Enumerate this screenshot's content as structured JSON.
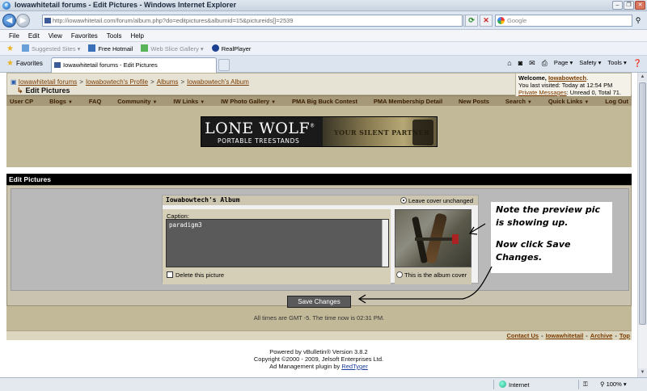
{
  "window": {
    "title": "Iowawhitetail forums - Edit Pictures - Windows Internet Explorer",
    "minimize": "–",
    "maximize": "❐",
    "close": "✕"
  },
  "address": {
    "url_host": "http://iowawhitetail.com",
    "url_path": "/forum/album.php?do=editpictures&albumid=15&pictureids[]=2539",
    "search_placeholder": "Google"
  },
  "menu": [
    "File",
    "Edit",
    "View",
    "Favorites",
    "Tools",
    "Help"
  ],
  "links_bar": {
    "suggested": "Suggested Sites ▾",
    "hotmail": "Free Hotmail",
    "webslice": "Web Slice Gallery ▾",
    "realplayer": "RealPlayer"
  },
  "tabs": {
    "favorites": "Favorites",
    "active_tab": "Iowawhitetail forums - Edit Pictures"
  },
  "commands": {
    "page": "Page ▾",
    "safety": "Safety ▾",
    "tools": "Tools ▾"
  },
  "breadcrumb": {
    "items": [
      "Iowawhitetail forums",
      "Iowabowtech's Profile",
      "Albums",
      "Iowabowtech's Album"
    ],
    "separator": ">",
    "page_title": "Edit Pictures"
  },
  "welcome": {
    "prefix": "Welcome,",
    "user": "Iowabowtech",
    "last_visited": "You last visited: Today at 12:54 PM",
    "pm_label": "Private Messages",
    "pm_status": ": Unread 0, Total 71."
  },
  "navbar": [
    "User CP",
    "Blogs",
    "FAQ",
    "Community",
    "IW Links",
    "IW Photo Gallery",
    "PMA Big Buck Contest",
    "PMA Membership Detail",
    "New Posts",
    "Search",
    "Quick Links",
    "Log Out"
  ],
  "banner": {
    "brand": "LONE WOLF",
    "tagline": "PORTABLE TREESTANDS",
    "partner": "YOUR SILENT PARTNER"
  },
  "section_title": "Edit Pictures",
  "album": {
    "title": "Iowabowtech's Album",
    "leave_cover": "Leave cover unchanged",
    "caption_label": "Caption:",
    "caption_value": "paradigm3",
    "delete_label": "Delete this picture",
    "album_cover_label": "This is the album cover"
  },
  "note": {
    "line1": "Note the preview pic is showing up.",
    "line2": "Now click Save Changes."
  },
  "save_button": "Save Changes",
  "gmt_text": "All times are GMT -5. The time now is 02:31 PM.",
  "footer_links": [
    "Contact Us",
    "Iowawhitetail",
    "Archive",
    "Top"
  ],
  "copyright": {
    "line1": "Powered by vBulletin® Version 3.8.2",
    "line2": "Copyright ©2000 - 2009, Jelsoft Enterprises Ltd.",
    "line3_prefix": "Ad Management plugin by",
    "line3_link": "RedTyger"
  },
  "status": {
    "zone": "Internet",
    "zoom": "100%"
  }
}
